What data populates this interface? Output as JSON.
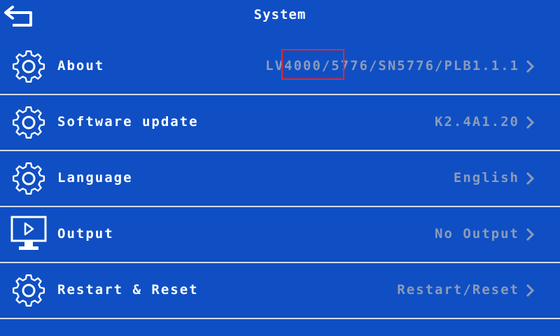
{
  "header": {
    "title": "System",
    "back_icon": "back-arrow-icon"
  },
  "rows": [
    {
      "label": "About",
      "value": "LV4000/5776/SN5776/PLB1.1.1",
      "icon": "gear-icon"
    },
    {
      "label": "Software update",
      "value": "K2.4A1.20",
      "icon": "gear-icon"
    },
    {
      "label": "Language",
      "value": "English",
      "icon": "gear-icon"
    },
    {
      "label": "Output",
      "value": "No Output",
      "icon": "monitor-icon"
    },
    {
      "label": "Restart & Reset",
      "value": "Restart/Reset",
      "icon": "gear-icon"
    }
  ],
  "colors": {
    "background": "#0f4fc3",
    "text": "#ffffff",
    "value_text": "#8d9bb8",
    "divider": "#d6dcea",
    "highlight": "#e8242b"
  }
}
